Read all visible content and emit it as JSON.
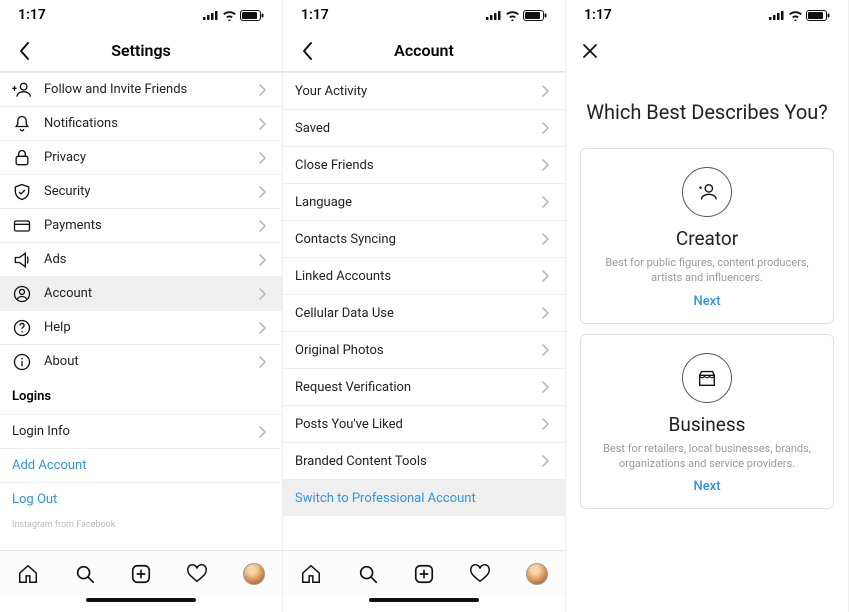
{
  "status": {
    "time": "1:17"
  },
  "screen1": {
    "title": "Settings",
    "rows": [
      {
        "name": "follow-invite",
        "label": "Follow and Invite Friends"
      },
      {
        "name": "notifications",
        "label": "Notifications"
      },
      {
        "name": "privacy",
        "label": "Privacy"
      },
      {
        "name": "security",
        "label": "Security"
      },
      {
        "name": "payments",
        "label": "Payments"
      },
      {
        "name": "ads",
        "label": "Ads"
      },
      {
        "name": "account",
        "label": "Account",
        "selected": true
      },
      {
        "name": "help",
        "label": "Help"
      },
      {
        "name": "about",
        "label": "About"
      }
    ],
    "logins_header": "Logins",
    "login_info": "Login Info",
    "add_account": "Add Account",
    "log_out": "Log Out",
    "footer": "Instagram from Facebook"
  },
  "screen2": {
    "title": "Account",
    "rows": [
      {
        "name": "your-activity",
        "label": "Your Activity"
      },
      {
        "name": "saved",
        "label": "Saved"
      },
      {
        "name": "close-friends",
        "label": "Close Friends"
      },
      {
        "name": "language",
        "label": "Language"
      },
      {
        "name": "contacts-syncing",
        "label": "Contacts Syncing"
      },
      {
        "name": "linked-accounts",
        "label": "Linked Accounts"
      },
      {
        "name": "cellular-data-use",
        "label": "Cellular Data Use"
      },
      {
        "name": "original-photos",
        "label": "Original Photos"
      },
      {
        "name": "request-verification",
        "label": "Request Verification"
      },
      {
        "name": "posts-youve-liked",
        "label": "Posts You've Liked"
      },
      {
        "name": "branded-content",
        "label": "Branded Content Tools"
      },
      {
        "name": "switch-professional",
        "label": "Switch to Professional Account",
        "link": true,
        "selected": true,
        "no_chevron": true
      }
    ]
  },
  "screen3": {
    "question": "Which Best Describes You?",
    "cards": [
      {
        "name": "creator",
        "title": "Creator",
        "desc": "Best for public figures, content producers, artists and influencers.",
        "next": "Next"
      },
      {
        "name": "business",
        "title": "Business",
        "desc": "Best for retailers, local businesses, brands, organizations and service providers.",
        "next": "Next"
      }
    ]
  }
}
